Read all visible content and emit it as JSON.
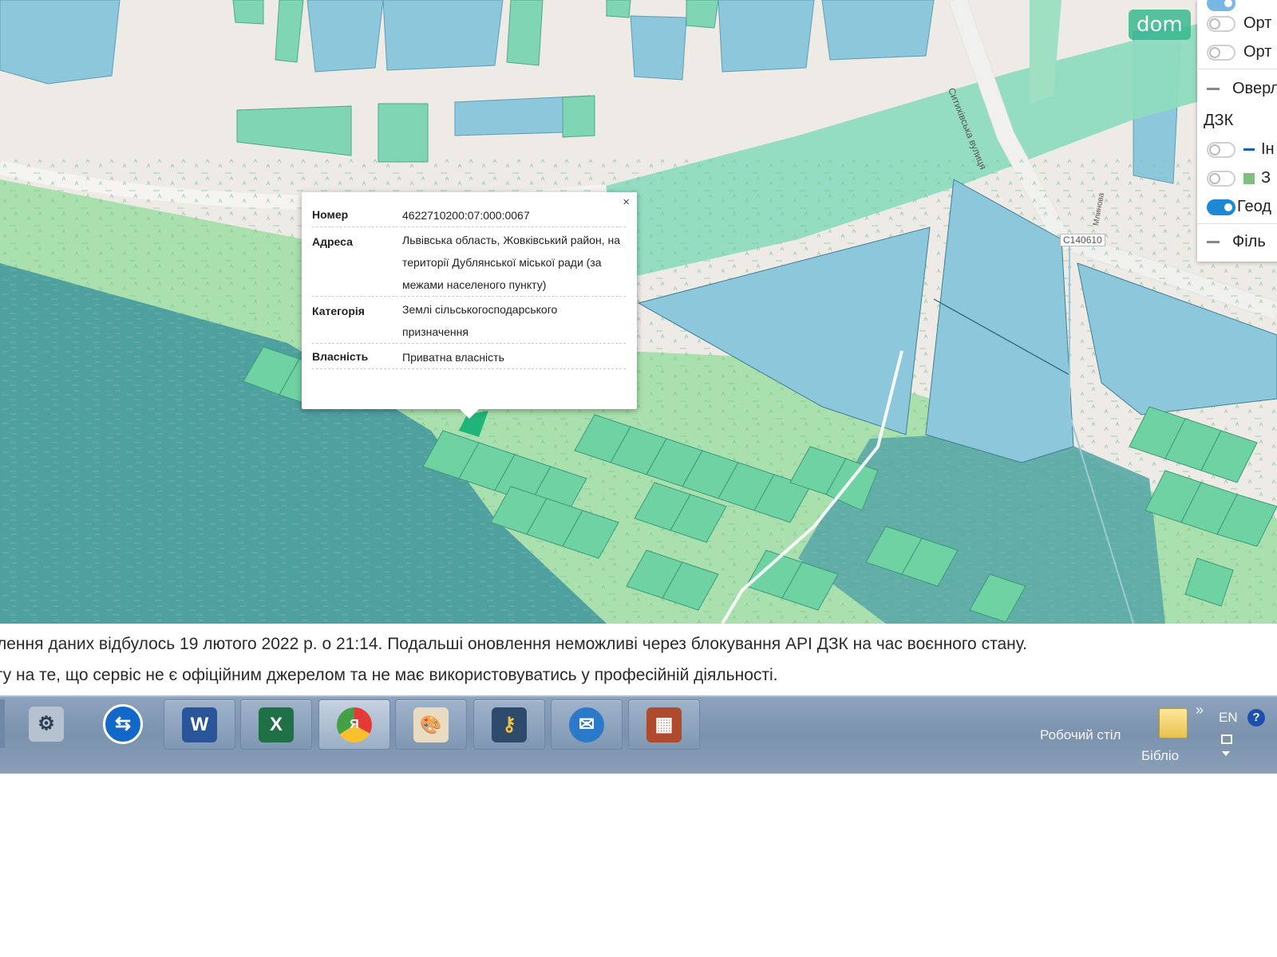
{
  "badge": {
    "text": "dom"
  },
  "road_labels": {
    "street": "Ситихівська вулиця",
    "road_code": "С140610",
    "small_road": "Млинова"
  },
  "layers_panel": {
    "rows": [
      {
        "label": "Орт",
        "on": false
      },
      {
        "label": "Орт",
        "on": false
      },
      {
        "section": "Оверл"
      },
      {
        "group": "ДЗК"
      },
      {
        "label": "Ін",
        "on": false,
        "swatch": "#1a5fb4",
        "swatch_type": "line"
      },
      {
        "label": "З",
        "on": false,
        "swatch": "#7fbf7f",
        "swatch_type": "square"
      },
      {
        "label": "Геод",
        "on": true
      },
      {
        "section": "Філь"
      }
    ]
  },
  "popup": {
    "close": "×",
    "rows": [
      {
        "key": "Номер",
        "value": "4622710200:07:000:0067"
      },
      {
        "key": "Адреса",
        "value": "Львівська область, Жовківський район, на території Дублянської міської ради (за межами населеного пункту)"
      },
      {
        "key": "Категорія",
        "value": "Землі сільськогосподарського призначення"
      },
      {
        "key": "Власність",
        "value": "Приватна власність"
      }
    ]
  },
  "notice": {
    "line1": "лення даних відбулось 19 лютого 2022 р. о 21:14. Подальші оновлення неможливі через блокування API ДЗК на час воєнного стану.",
    "line2": "гу на те, що сервіс не є офіційним джерелом та не має використовуватись у професійній діяльності."
  },
  "taskbar": {
    "apps": [
      {
        "name": "network-tool",
        "glyph": "⚙"
      },
      {
        "name": "teamviewer",
        "glyph": "⇆"
      },
      {
        "name": "word",
        "glyph": "W"
      },
      {
        "name": "excel",
        "glyph": "X"
      },
      {
        "name": "yandex-browser",
        "glyph": "Я"
      },
      {
        "name": "paint",
        "glyph": "🎨"
      },
      {
        "name": "keys",
        "glyph": "⚷"
      },
      {
        "name": "mail",
        "glyph": "✉"
      },
      {
        "name": "archive",
        "glyph": "▦"
      }
    ],
    "desktop_label": "Робочий стіл",
    "library_label": "Бібліо",
    "lang": "EN",
    "more": "»",
    "help": "?"
  },
  "colors": {
    "water": "#4fa1a0",
    "meadow": "#9cd9a3",
    "parcel": "#5fcfa0",
    "blue_parcel": "#8dc7dc",
    "road": "#ffffff"
  }
}
